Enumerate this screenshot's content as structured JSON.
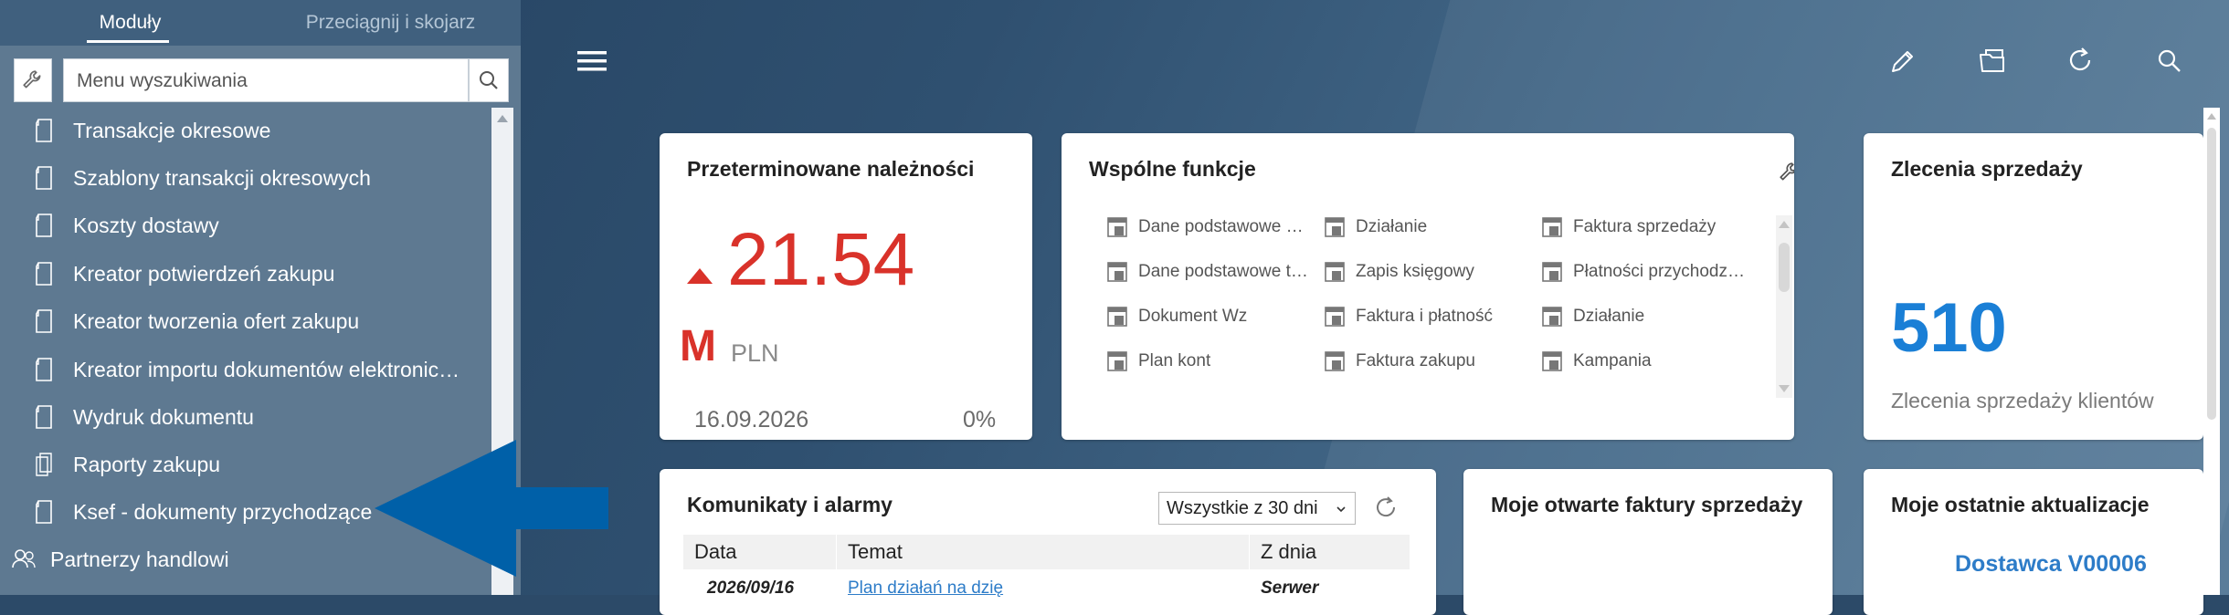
{
  "colors": {
    "accent_red": "#d9322a",
    "accent_blue": "#1a7fd6",
    "link_blue": "#2d7cc8",
    "sidebar": "#5e7991",
    "arrow": "#0060a8"
  },
  "left_panel": {
    "tabs": {
      "modules": "Moduły",
      "drag": "Przeciągnij i skojarz"
    },
    "search": {
      "placeholder": "Menu wyszukiwania"
    },
    "items": [
      {
        "label": "Transakcje okresowe",
        "icon": "document-icon"
      },
      {
        "label": "Szablony transakcji okresowych",
        "icon": "document-icon"
      },
      {
        "label": "Koszty dostawy",
        "icon": "document-icon"
      },
      {
        "label": "Kreator potwierdzeń zakupu",
        "icon": "document-icon"
      },
      {
        "label": "Kreator tworzenia ofert zakupu",
        "icon": "document-icon"
      },
      {
        "label": "Kreator importu dokumentów elektronic…",
        "icon": "document-icon"
      },
      {
        "label": "Wydruk dokumentu",
        "icon": "document-icon"
      },
      {
        "label": "Raporty zakupu",
        "icon": "reports-icon"
      },
      {
        "label": "Ksef - dokumenty przychodzące",
        "icon": "document-icon"
      },
      {
        "label": "Partnerzy handlowi",
        "icon": "partners-icon"
      }
    ]
  },
  "cards": {
    "overdue": {
      "title": "Przeterminowane należności",
      "value": "21.54",
      "scale": "M",
      "unit": "PLN",
      "date": "16.09.2026",
      "percent": "0%"
    },
    "functions": {
      "title": "Wspólne funkcje",
      "items": [
        "Dane podstawowe …",
        "Działanie",
        "Faktura sprzedaży",
        "Dane podstawowe t…",
        "Zapis księgowy",
        "Płatności przychodz…",
        "Dokument Wz",
        "Faktura i płatność",
        "Działanie",
        "Plan kont",
        "Faktura zakupu",
        "Kampania"
      ]
    },
    "sales_orders": {
      "title": "Zlecenia sprzedaży",
      "value": "510",
      "subtitle": "Zlecenia sprzedaży klientów"
    },
    "alerts": {
      "title": "Komunikaty i alarmy",
      "filter": "Wszystkie z 30 dni",
      "columns": [
        "Data",
        "Temat",
        "Z dnia"
      ],
      "row": {
        "date": "2026/09/16",
        "subject": "Plan działań na dzię",
        "from": "Serwer"
      }
    },
    "open_invoices": {
      "title": "Moje otwarte faktury sprzedaży"
    },
    "latest_updates": {
      "title": "Moje ostatnie aktualizacje",
      "value": "Dostawca V00006"
    }
  }
}
